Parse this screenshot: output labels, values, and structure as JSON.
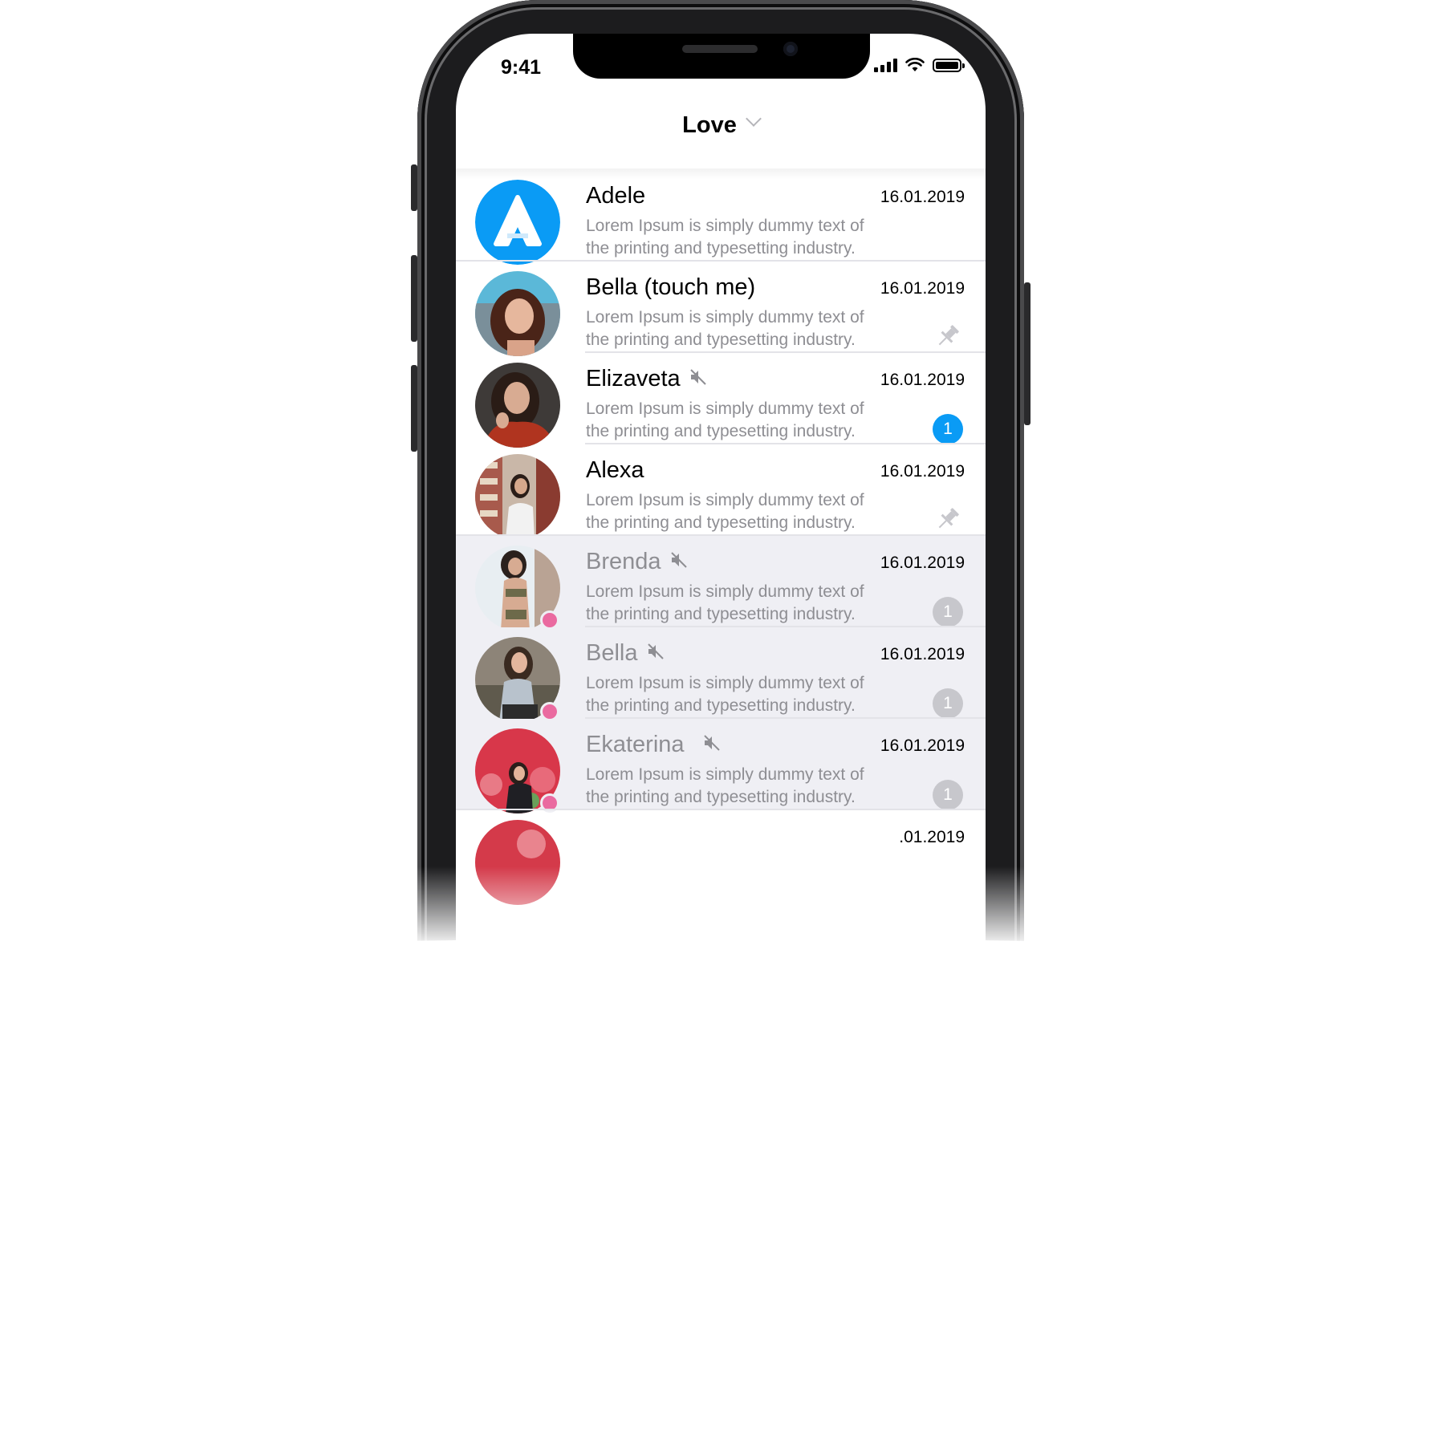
{
  "status_bar": {
    "time": "9:41"
  },
  "nav": {
    "title": "Love"
  },
  "chats": [
    {
      "name": "Adele",
      "date": "16.01.2019",
      "msg1": "Lorem Ipsum is simply dummy text of",
      "msg2": "the printing and typesetting industry.",
      "muted": false,
      "pinned": false,
      "badge": "",
      "online": false,
      "highlight": false,
      "avatar": "app-logo"
    },
    {
      "name": "Bella (touch me)",
      "date": "16.01.2019",
      "msg1": "Lorem Ipsum is simply dummy text of",
      "msg2": "the printing and typesetting industry.",
      "muted": false,
      "pinned": true,
      "badge": "",
      "online": false,
      "highlight": false,
      "avatar": "photo"
    },
    {
      "name": "Elizaveta",
      "date": "16.01.2019",
      "msg1": "Lorem Ipsum is simply dummy text of",
      "msg2": "the printing and typesetting industry.",
      "muted": true,
      "pinned": false,
      "badge": "1",
      "online": false,
      "highlight": false,
      "avatar": "photo"
    },
    {
      "name": "Alexa",
      "date": "16.01.2019",
      "msg1": "Lorem Ipsum is simply dummy text of",
      "msg2": "the printing and typesetting industry.",
      "muted": false,
      "pinned": true,
      "badge": "",
      "online": false,
      "highlight": false,
      "avatar": "photo"
    },
    {
      "name": "Brenda",
      "date": "16.01.2019",
      "msg1": "Lorem Ipsum is simply dummy text of",
      "msg2": "the printing and typesetting industry.",
      "muted": true,
      "pinned": false,
      "badge": "1",
      "online": true,
      "highlight": true,
      "avatar": "photo"
    },
    {
      "name": "Bella",
      "date": "16.01.2019",
      "msg1": "Lorem Ipsum is simply dummy text of",
      "msg2": "the printing and typesetting industry.",
      "muted": true,
      "pinned": false,
      "badge": "1",
      "online": true,
      "highlight": true,
      "avatar": "photo"
    },
    {
      "name": "Ekaterina",
      "date": "16.01.2019",
      "msg1": "Lorem Ipsum is simply dummy text of",
      "msg2": "the printing and typesetting industry.",
      "muted": true,
      "pinned": false,
      "badge": "1",
      "online": true,
      "highlight": true,
      "avatar": "photo"
    }
  ],
  "partial_row": {
    "date": ".01.2019"
  },
  "colors": {
    "accent": "#0a9bf5",
    "online": "#ea6aa0",
    "muted_bg": "#efeff4",
    "secondary_text": "#8e8e93",
    "badge_grey": "#c7c7cc"
  },
  "icons": {
    "mute": "speaker-muted-icon",
    "pin": "pin-icon",
    "chevron": "chevron-down-icon"
  }
}
